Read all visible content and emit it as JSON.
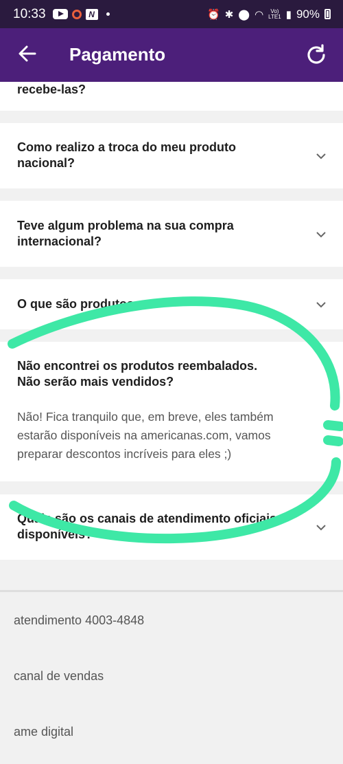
{
  "status_bar": {
    "time": "10:33",
    "battery": "90%",
    "network_label_top": "Vo)",
    "network_label_bottom": "LTE1"
  },
  "app_bar": {
    "title": "Pagamento"
  },
  "faq": {
    "partial_question": "recebe-las?",
    "items": [
      {
        "question": "Como realizo a troca do meu produto nacional?",
        "expanded": false
      },
      {
        "question": "Teve algum problema na sua compra internacional?",
        "expanded": false
      },
      {
        "question": "O que são produtos ... ?",
        "expanded": false
      },
      {
        "question": "Não encontrei os produtos reembalados. Não serão mais vendidos?",
        "expanded": true,
        "answer": "Não! Fica tranquilo que, em breve, eles também estarão disponíveis na americanas.com, vamos preparar descontos incríveis para eles ;)"
      },
      {
        "question": "Quais são os canais de atendimento oficiais disponíveis?",
        "expanded": false
      }
    ]
  },
  "footer": {
    "items": [
      "atendimento 4003-4848",
      "canal de vendas",
      "ame digital"
    ]
  },
  "colors": {
    "app_bar": "#4c1f7a",
    "status_bar": "#2a1a3e",
    "annotation": "#3ee8a6"
  }
}
